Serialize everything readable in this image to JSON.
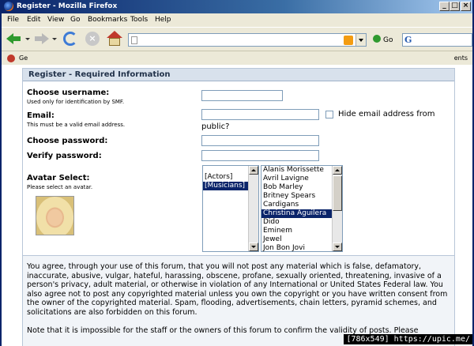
{
  "window": {
    "title": "Register - Mozilla Firefox"
  },
  "menubar": {
    "items": [
      {
        "label": "File",
        "accel": "F"
      },
      {
        "label": "Edit",
        "accel": "E"
      },
      {
        "label": "View",
        "accel": "V"
      },
      {
        "label": "Go",
        "accel": "G"
      },
      {
        "label": "Bookmarks",
        "accel": "B"
      },
      {
        "label": "Tools",
        "accel": "T"
      },
      {
        "label": "Help",
        "accel": "H"
      }
    ]
  },
  "navbar": {
    "url_value": "",
    "go_label": "Go",
    "search_engine": "G"
  },
  "bookmarks": {
    "first_label": "Ge",
    "overflow_label": "ents"
  },
  "form": {
    "header": "Register - Required Information",
    "username_label": "Choose username:",
    "username_hint": "Used only for identification by SMF.",
    "email_label": "Email:",
    "email_hint": "This must be a valid email address.",
    "hide_email_label": "Hide email address from",
    "hide_email_label_cont": "public?",
    "password_label": "Choose password:",
    "verify_label": "Verify password:",
    "avatar_label": "Avatar Select:",
    "avatar_hint": "Please select an avatar.",
    "avatar_categories": [
      "[Actors]",
      "[Musicians]"
    ],
    "avatar_category_selected": "[Musicians]",
    "avatar_names": [
      "Alanis Morissette",
      "Avril Lavigne",
      "Bob Marley",
      "Britney Spears",
      "Cardigans",
      "Christina Aguilera",
      "Dido",
      "Eminem",
      "Jewel",
      "Jon Bon Jovi"
    ],
    "avatar_name_selected": "Christina Aguilera"
  },
  "agreement": {
    "para1": "You agree, through your use of this forum, that you will not post any material which is false, defamatory, inaccurate, abusive, vulgar, hateful, harassing, obscene, profane, sexually oriented, threatening, invasive of a person's privacy, adult material, or otherwise in violation of any International or United States Federal law. You also agree not to post any copyrighted material unless you own the copyright or you have written consent from the owner of the copyrighted material. Spam, flooding, advertisements, chain letters, pyramid schemes, and solicitations are also forbidden on this forum.",
    "para2_partial": "Note that it is impossible for the staff or the owners of this forum to confirm the validity of posts. Please"
  },
  "watermark": "[786x549] https://upic.me/"
}
